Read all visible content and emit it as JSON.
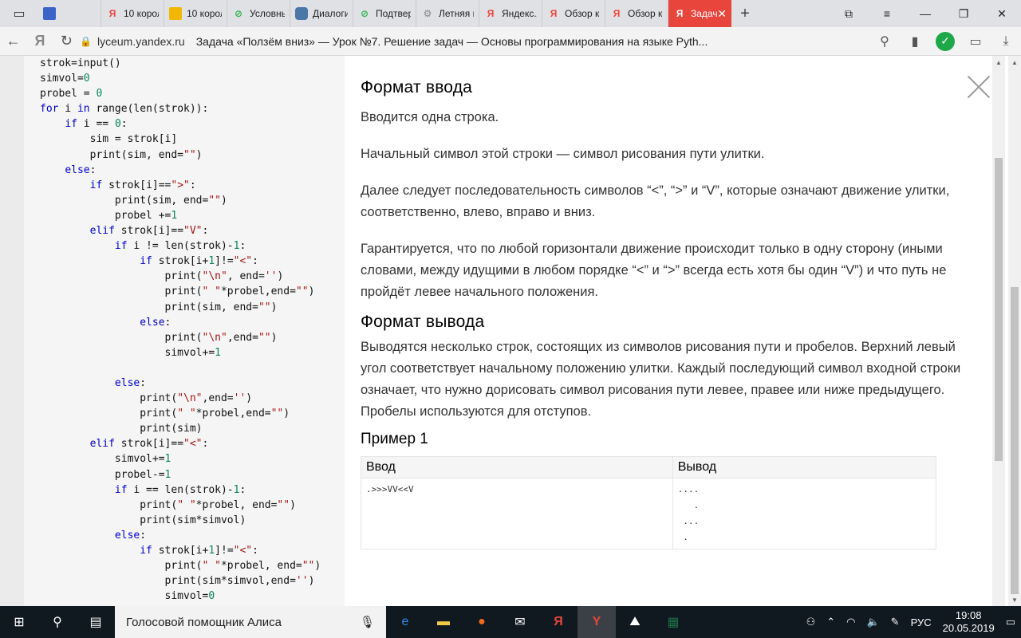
{
  "browser": {
    "tabs": [
      {
        "icon": "blue-doc-icon",
        "label": "",
        "color": "#3b64c8"
      },
      {
        "icon": "yandex-icon",
        "label": "10 корол",
        "color": "#e8453c"
      },
      {
        "icon": "image-icon",
        "label": "10 корол",
        "color": "#f2b705"
      },
      {
        "icon": "green-circle-icon",
        "label": "Условнь",
        "color": "#2bb24c"
      },
      {
        "icon": "chat-icon",
        "label": "Диалоги",
        "color": "#4a76a8"
      },
      {
        "icon": "green-circle-icon",
        "label": "Подтвер",
        "color": "#2bb24c"
      },
      {
        "icon": "gear-icon",
        "label": "Летняя ш",
        "color": "#888888"
      },
      {
        "icon": "yandex-icon",
        "label": "Яндекс.Л",
        "color": "#e8453c"
      },
      {
        "icon": "yandex-icon",
        "label": "Обзор к",
        "color": "#e8453c"
      },
      {
        "icon": "yandex-icon",
        "label": "Обзор к",
        "color": "#e8453c"
      }
    ],
    "active_tab": {
      "label": "Задач",
      "icon": "yandex-icon"
    },
    "address": {
      "host": "lyceum.yandex.ru",
      "title": "Задача «Ползём вниз» — Урок №7. Решение задач — Основы программирования на языке Pyth..."
    }
  },
  "code_lines": [
    "strok=input()",
    "simvol=0",
    "probel = 0",
    "for i in range(len(strok)):",
    "    if i == 0:",
    "        sim = strok[i]",
    "        print(sim, end=\"\")",
    "    else:",
    "        if strok[i]==\">\":",
    "            print(sim, end=\"\")",
    "            probel +=1",
    "        elif strok[i]==\"V\":",
    "            if i != len(strok)-1:",
    "                if strok[i+1]!=\"<\":",
    "                    print(\"\\n\", end='')",
    "                    print(\" \"*probel,end=\"\")",
    "                    print(sim, end=\"\")",
    "                else:",
    "                    print(\"\\n\",end=\"\")",
    "                    simvol+=1",
    "",
    "            else:",
    "                print(\"\\n\",end='')",
    "                print(\" \"*probel,end=\"\")",
    "                print(sim)",
    "        elif strok[i]==\"<\":",
    "            simvol+=1",
    "            probel-=1",
    "            if i == len(strok)-1:",
    "                print(\" \"*probel, end=\"\")",
    "                print(sim*simvol)",
    "            else:",
    "                if strok[i+1]!=\"<\":",
    "                    print(\" \"*probel, end=\"\")",
    "                    print(sim*simvol,end='')",
    "                    simvol=0"
  ],
  "task": {
    "input_heading": "Формат ввода",
    "input_paragraphs": [
      "Вводится одна строка.",
      "Начальный символ этой строки — символ рисования пути улитки.",
      "Далее следует последовательность символов “<”, “>” и “V”, которые означают движение улитки, соответственно, влево, вправо и вниз.",
      "Гарантируется, что по любой горизонтали движение происходит только в одну сторону (иными словами, между идущими в любом порядке “<” и “>” всегда есть хотя бы один “V”) и что путь не пройдёт левее начального положения."
    ],
    "output_heading": "Формат вывода",
    "output_paragraph": "Выводятся несколько строк, состоящих из символов рисования пути и пробелов. Верхний левый угол соответствует начальному положению улитки. Каждый последующий символ входной строки означает, что нужно дорисовать символ рисования пути левее, правее или ниже предыдущего. Пробелы используются для отступов.",
    "example_heading": "Пример 1",
    "example": {
      "col_in": "Ввод",
      "col_out": "Вывод",
      "input": ".>>>VV<<V",
      "output": "....\n   .\n ...\n ."
    }
  },
  "taskbar": {
    "search_text": "Голосовой помощник Алиса",
    "lang": "РУС",
    "time": "19:08",
    "date": "20.05.2019"
  }
}
